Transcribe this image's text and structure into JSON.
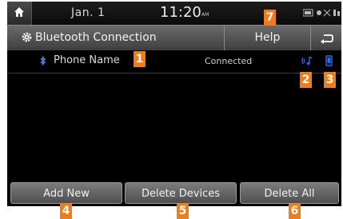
{
  "status_bar": {
    "date": "Jan.  1",
    "time": "11:20",
    "ampm": "AM"
  },
  "title_bar": {
    "title": "Bluetooth Connection",
    "help_label": "Help"
  },
  "device": {
    "name": "Phone Name",
    "status": "Connected"
  },
  "buttons": {
    "add_new": "Add New",
    "delete_devices": "Delete Devices",
    "delete_all": "Delete All"
  },
  "callouts": [
    "1",
    "2",
    "3",
    "4",
    "5",
    "6",
    "7"
  ],
  "colors": {
    "callout": "#f07c1a",
    "bluetooth": "#4a8cff",
    "accent_blue": "#2f6ee6"
  }
}
